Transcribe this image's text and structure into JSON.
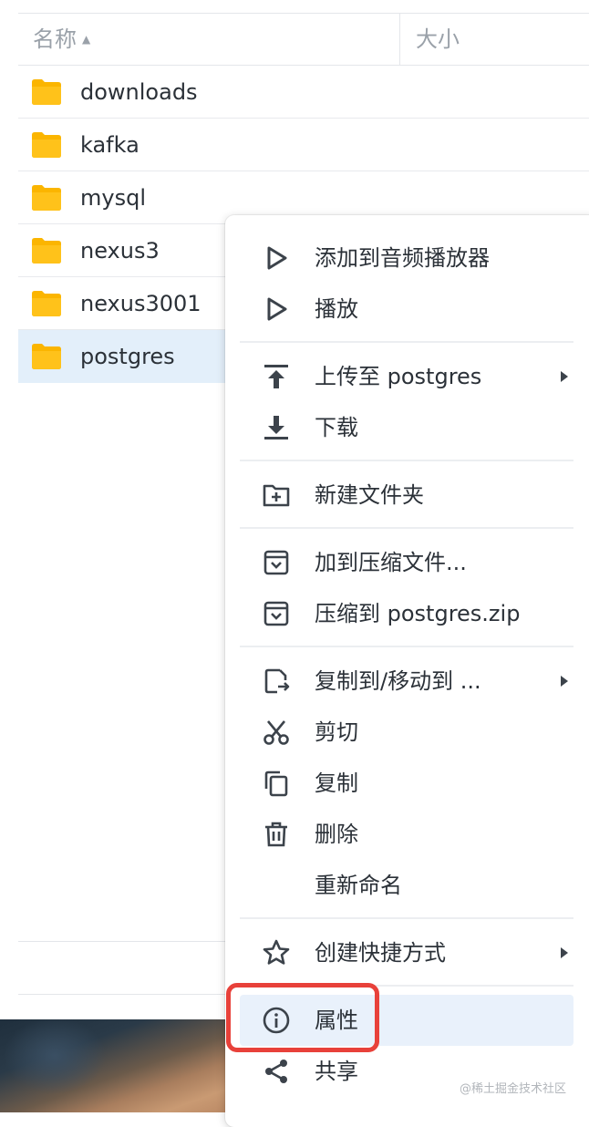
{
  "file_list": {
    "columns": {
      "name": "名称",
      "size": "大小"
    },
    "rows": [
      {
        "name": "downloads",
        "icon": "folder-icon",
        "selected": false
      },
      {
        "name": "kafka",
        "icon": "folder-icon",
        "selected": false
      },
      {
        "name": "mysql",
        "icon": "folder-icon",
        "selected": false
      },
      {
        "name": "nexus3",
        "icon": "folder-icon",
        "selected": false
      },
      {
        "name": "nexus3001",
        "icon": "folder-icon",
        "selected": false
      },
      {
        "name": "postgres",
        "icon": "folder-icon",
        "selected": true
      }
    ]
  },
  "context_menu": {
    "items": [
      {
        "label": "添加到音频播放器",
        "icon": "play-icon"
      },
      {
        "label": "播放",
        "icon": "play-icon"
      },
      {
        "label": "上传至 postgres",
        "icon": "upload-icon",
        "submenu": true
      },
      {
        "label": "下载",
        "icon": "download-icon"
      },
      {
        "label": "新建文件夹",
        "icon": "new-folder-icon"
      },
      {
        "label": "加到压缩文件...",
        "icon": "archive-icon"
      },
      {
        "label": "压缩到 postgres.zip",
        "icon": "archive-icon"
      },
      {
        "label": "复制到/移动到 ...",
        "icon": "copy-move-icon",
        "submenu": true
      },
      {
        "label": "剪切",
        "icon": "scissors-icon"
      },
      {
        "label": "复制",
        "icon": "copy-icon"
      },
      {
        "label": "删除",
        "icon": "trash-icon"
      },
      {
        "label": "重新命名",
        "icon": ""
      },
      {
        "label": "创建快捷方式",
        "icon": "star-icon",
        "submenu": true
      },
      {
        "label": "属性",
        "icon": "info-icon",
        "highlighted": true
      },
      {
        "label": "共享",
        "icon": "share-icon"
      }
    ]
  },
  "watermark": "@稀土掘金技术社区",
  "colors": {
    "folder": "#fbb500",
    "selected_row": "#e3effa",
    "menu_highlight": "#e9f1fb",
    "annotation_box": "#e8413a"
  }
}
